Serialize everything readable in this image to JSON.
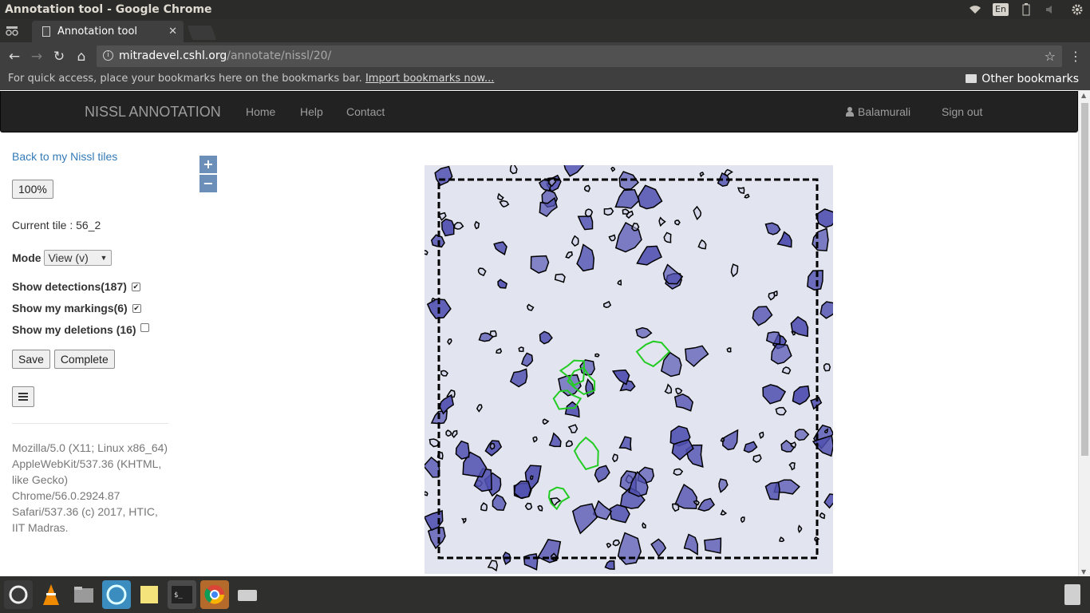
{
  "window": {
    "title": "Annotation tool - Google Chrome",
    "language_indicator": "En"
  },
  "browser": {
    "tab_title": "Annotation tool",
    "url_host": "mitradevel.cshl.org",
    "url_path": "/annotate/nissl/20/",
    "bookmarks_hint": "For quick access, place your bookmarks here on the bookmarks bar.",
    "import_link": "Import bookmarks now...",
    "other_bookmarks": "Other bookmarks"
  },
  "navbar": {
    "brand": "NISSL ANNOTATION",
    "links": [
      "Home",
      "Help",
      "Contact"
    ],
    "user": "Balamurali",
    "sign_out": "Sign out"
  },
  "sidebar": {
    "back_link": "Back to my Nissl tiles",
    "zoom_label": "100%",
    "current_tile_label": "Current tile : 56_2",
    "mode_label": "Mode",
    "mode_value": "View (v)",
    "checkboxes": [
      {
        "label": "Show detections(187)",
        "checked": true
      },
      {
        "label": "Show my markings(6)",
        "checked": true
      },
      {
        "label": "Show my deletions (16)",
        "checked": false
      }
    ],
    "save_label": "Save",
    "complete_label": "Complete",
    "user_agent": "Mozilla/5.0 (X11; Linux x86_64) AppleWebKit/537.36 (KHTML, like Gecko) Chrome/56.0.2924.87 Safari/537.36 (c) 2017, HTIC, IIT Madras."
  },
  "map_controls": {
    "zoom_in": "+",
    "zoom_out": "−"
  },
  "colors": {
    "detection_outline": "#000000",
    "marking_outline": "#22cc22",
    "cell_stain": "#5050b0",
    "tissue_background": "#e2e4f0"
  }
}
